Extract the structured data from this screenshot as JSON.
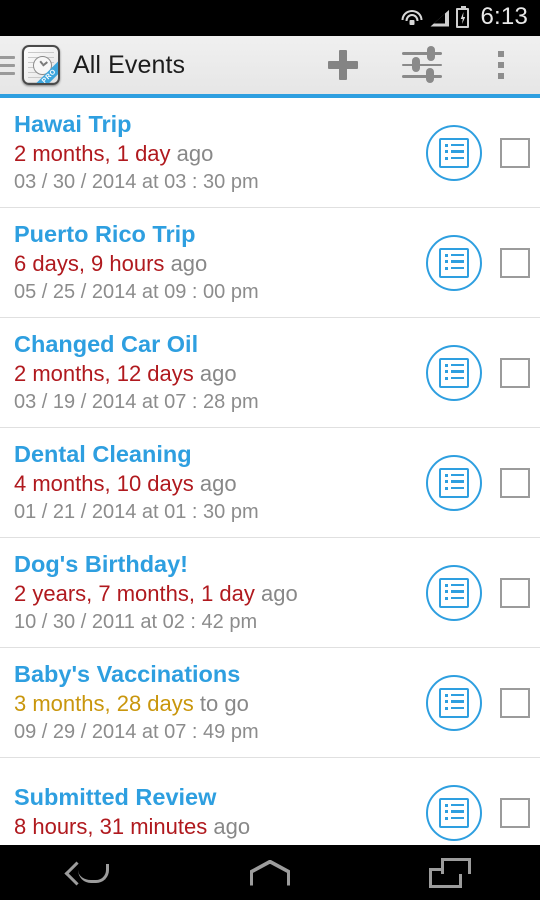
{
  "status_bar": {
    "time": "6:13",
    "icons": [
      "wifi-icon",
      "signal-icon",
      "battery-charging-icon"
    ]
  },
  "action_bar": {
    "title": "All Events",
    "app_icon_badge": "PRO",
    "actions": [
      {
        "name": "add-event-button",
        "icon": "plus-icon"
      },
      {
        "name": "filter-button",
        "icon": "sliders-icon"
      },
      {
        "name": "overflow-menu-button",
        "icon": "more-vertical-icon"
      }
    ]
  },
  "colors": {
    "accent": "#2e9fe0",
    "past": "#b0191e",
    "future": "#c9960c",
    "muted": "#8c8c8c"
  },
  "events": [
    {
      "title": "Hawai Trip",
      "duration": "2 months, 1 day",
      "suffix": "ago",
      "tense": "past",
      "date": "03 / 30 / 2014 at 03 : 30 pm",
      "checked": false
    },
    {
      "title": "Puerto Rico Trip",
      "duration": "6 days, 9 hours",
      "suffix": "ago",
      "tense": "past",
      "date": "05 / 25 / 2014 at 09 : 00 pm",
      "checked": false
    },
    {
      "title": "Changed Car Oil",
      "duration": "2 months, 12 days",
      "suffix": "ago",
      "tense": "past",
      "date": "03 / 19 / 2014 at 07 : 28 pm",
      "checked": false
    },
    {
      "title": "Dental Cleaning",
      "duration": "4 months, 10 days",
      "suffix": "ago",
      "tense": "past",
      "date": "01 / 21 / 2014 at 01 : 30 pm",
      "checked": false
    },
    {
      "title": "Dog's Birthday!",
      "duration": "2 years, 7 months, 1 day",
      "suffix": "ago",
      "tense": "past",
      "date": "10 / 30 / 2011 at 02 : 42 pm",
      "checked": false
    },
    {
      "title": "Baby's Vaccinations",
      "duration": "3 months, 28 days",
      "suffix": "to go",
      "tense": "future",
      "date": "09 / 29 / 2014 at 07 : 49 pm",
      "checked": false
    },
    {
      "title": "Submitted Review",
      "duration": "8 hours, 31 minutes",
      "suffix": "ago",
      "tense": "past",
      "date": "",
      "checked": false
    }
  ],
  "nav_bar": {
    "buttons": [
      {
        "name": "nav-back-button",
        "icon": "back-arrow-icon"
      },
      {
        "name": "nav-home-button",
        "icon": "home-icon"
      },
      {
        "name": "nav-recents-button",
        "icon": "recents-icon"
      }
    ]
  }
}
